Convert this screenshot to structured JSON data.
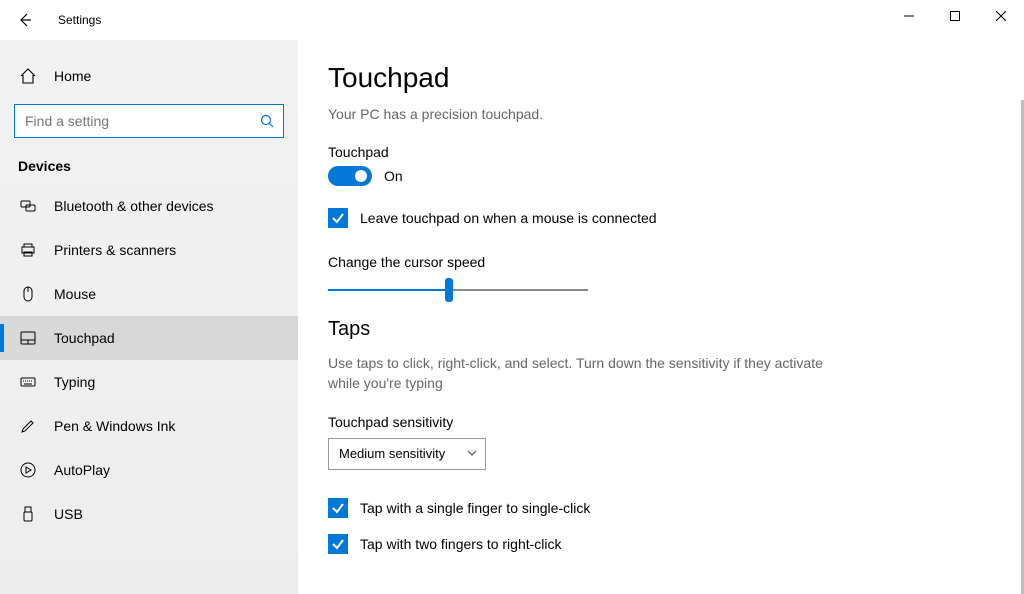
{
  "window": {
    "title": "Settings"
  },
  "sidebar": {
    "home": "Home",
    "search_placeholder": "Find a setting",
    "section": "Devices",
    "items": [
      {
        "label": "Bluetooth & other devices"
      },
      {
        "label": "Printers & scanners"
      },
      {
        "label": "Mouse"
      },
      {
        "label": "Touchpad"
      },
      {
        "label": "Typing"
      },
      {
        "label": "Pen & Windows Ink"
      },
      {
        "label": "AutoPlay"
      },
      {
        "label": "USB"
      }
    ]
  },
  "main": {
    "title": "Touchpad",
    "subtitle": "Your PC has a precision touchpad.",
    "toggle_group_label": "Touchpad",
    "toggle_state_label": "On",
    "leave_on_label": "Leave touchpad on when a mouse is connected",
    "cursor_speed_label": "Change the cursor speed",
    "cursor_speed_value": 45,
    "taps_title": "Taps",
    "taps_desc": "Use taps to click, right-click, and select. Turn down the sensitivity if they activate while you're typing",
    "sensitivity_label": "Touchpad sensitivity",
    "sensitivity_value": "Medium sensitivity",
    "tap_single_label": "Tap with a single finger to single-click",
    "tap_two_label": "Tap with two fingers to right-click"
  }
}
